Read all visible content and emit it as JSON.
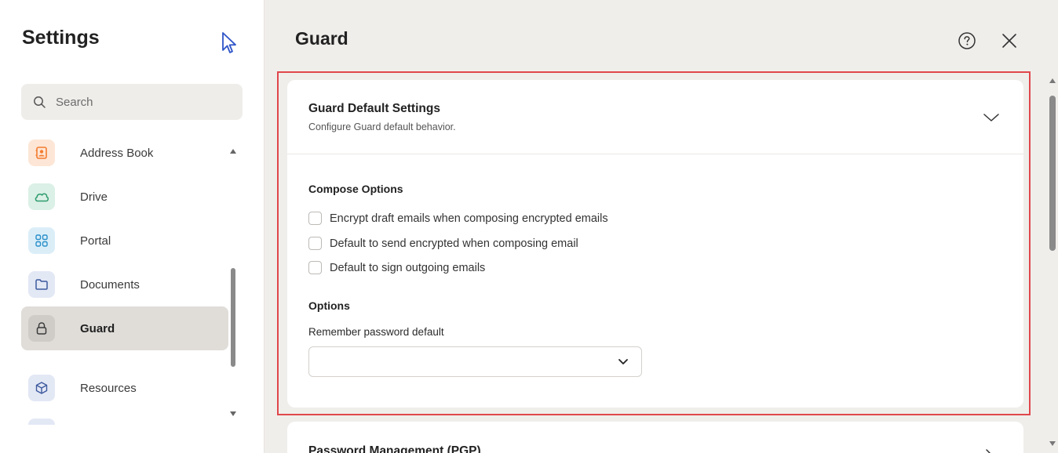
{
  "sidebar": {
    "title": "Settings",
    "search": {
      "placeholder": "Search",
      "icon": "search-icon"
    },
    "items": [
      {
        "label": "Address Book",
        "icon": "address-book-icon",
        "color": "#f47c30",
        "bg": "#fde6d6"
      },
      {
        "label": "Drive",
        "icon": "cloud-icon",
        "color": "#2f9c6e",
        "bg": "#dbf0e6"
      },
      {
        "label": "Portal",
        "icon": "grid-icon",
        "color": "#2a8fc9",
        "bg": "#dbeef8"
      },
      {
        "label": "Documents",
        "icon": "folder-icon",
        "color": "#3d5a9e",
        "bg": "#e3e8f5"
      },
      {
        "label": "Guard",
        "icon": "lock-icon",
        "color": "#3a3a3a",
        "bg": "#cfccc8",
        "active": true
      },
      {
        "label": "Resources",
        "icon": "cube-icon",
        "color": "#3d5a9e",
        "bg": "#e3e8f5"
      }
    ]
  },
  "main": {
    "title": "Guard",
    "help_icon": "help-icon",
    "close_icon": "close-icon",
    "highlight_color": "#e0474c",
    "card": {
      "title": "Guard Default Settings",
      "subtitle": "Configure Guard default behavior.",
      "compose_label": "Compose Options",
      "checkboxes": [
        {
          "label": "Encrypt draft emails when composing encrypted emails",
          "checked": false
        },
        {
          "label": "Default to send encrypted when composing email",
          "checked": false
        },
        {
          "label": "Default to sign outgoing emails",
          "checked": false
        }
      ],
      "options_label": "Options",
      "remember_label": "Remember password default",
      "remember_value": ""
    },
    "next_card": {
      "title": "Password Management (PGP)"
    }
  }
}
